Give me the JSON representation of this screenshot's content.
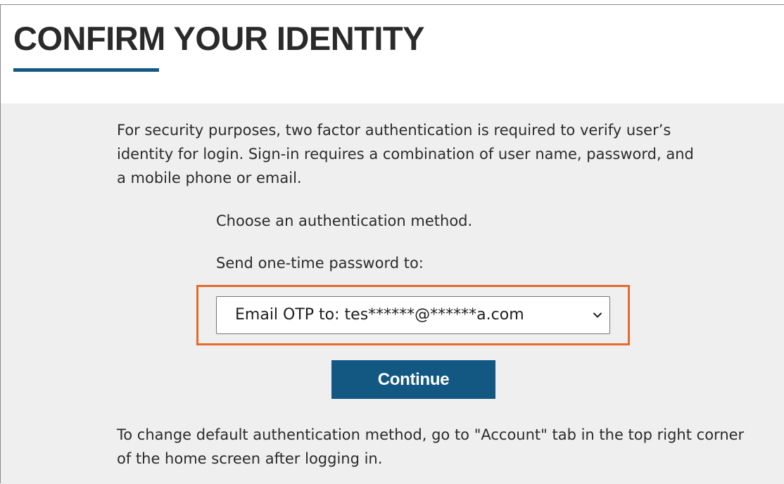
{
  "header": {
    "title": "CONFIRM YOUR IDENTITY"
  },
  "main": {
    "intro": "For security purposes, two factor authentication is required to verify user’s identity for login. Sign-in requires a combination of user name, password, and a mobile phone or email.",
    "choose_label": "Choose an authentication method.",
    "send_label": "Send one-time password to:",
    "method_select": {
      "selected": "Email OTP to: tes******@******a.com",
      "icon": "chevron-down-icon"
    },
    "continue_label": "Continue",
    "footer_note": "To change default authentication method, go to \"Account\" tab in the top right corner of the home screen after logging in."
  },
  "colors": {
    "accent": "#125882",
    "highlight": "#e56a2c",
    "panel_background": "#efefef"
  }
}
